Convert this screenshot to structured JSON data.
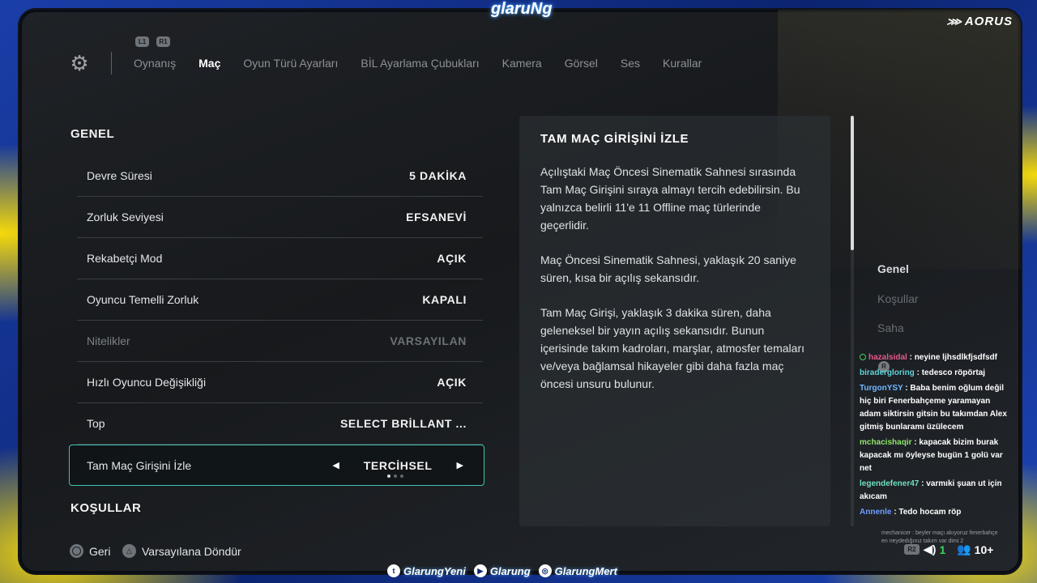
{
  "overlay": {
    "brand": "glaruNg",
    "aorus": "AORUS",
    "social": [
      {
        "icon": "twitter-icon",
        "glyph": "t",
        "label": "GlarungYeni"
      },
      {
        "icon": "youtube-icon",
        "glyph": "▶",
        "label": "Glarung"
      },
      {
        "icon": "instagram-icon",
        "glyph": "◎",
        "label": "GlarungMert"
      }
    ]
  },
  "nav": {
    "shoulder_left": "L1",
    "shoulder_right": "R1",
    "tabs": [
      "Oynanış",
      "Maç",
      "Oyun Türü Ayarları",
      "BİL Ayarlama Çubukları",
      "Kamera",
      "Görsel",
      "Ses",
      "Kurallar"
    ],
    "active_tab": "Maç"
  },
  "settings": {
    "section_general": "GENEL",
    "section_conditions": "KOŞULLAR",
    "rows": [
      {
        "label": "Devre Süresi",
        "value": "5 DAKİKA",
        "disabled": false
      },
      {
        "label": "Zorluk Seviyesi",
        "value": "EFSANEVİ",
        "disabled": false
      },
      {
        "label": "Rekabetçi Mod",
        "value": "AÇIK",
        "disabled": false
      },
      {
        "label": "Oyuncu Temelli Zorluk",
        "value": "KAPALI",
        "disabled": false
      },
      {
        "label": "Nitelikler",
        "value": "VARSAYILAN",
        "disabled": true
      },
      {
        "label": "Hızlı Oyuncu Değişikliği",
        "value": "AÇIK",
        "disabled": false
      },
      {
        "label": "Top",
        "value": "SELECT BRİLLANT ...",
        "disabled": false
      }
    ],
    "selected": {
      "label": "Tam Maç Girişini İzle",
      "value": "TERCİHSEL",
      "left_arrow": "◀",
      "right_arrow": "▶",
      "option_index": 1,
      "option_count": 3
    }
  },
  "description": {
    "title": "TAM MAÇ GİRİŞİNİ İZLE",
    "paragraphs": [
      "Açılıştaki Maç Öncesi Sinematik Sahnesi sırasında Tam Maç Girişini sıraya almayı tercih edebilirsin. Bu yalnızca belirli 11'e 11 Offline maç türlerinde geçerlidir.",
      "Maç Öncesi Sinematik Sahnesi, yaklaşık 20 saniye süren, kısa bir açılış sekansıdır.",
      "Tam Maç Girişi, yaklaşık 3 dakika süren, daha geleneksel bir yayın açılış sekansıdır. Bunun içerisinde takım kadroları, marşlar, atmosfer temaları ve/veya bağlamsal hikayeler gibi daha fazla maç öncesi unsuru bulunur."
    ]
  },
  "side_sections": [
    {
      "label": "Genel",
      "active": true
    },
    {
      "label": "Koşullar",
      "active": false
    },
    {
      "label": "Saha",
      "active": false
    }
  ],
  "chat": {
    "messages": [
      {
        "user": "hazalsidal",
        "color": "#e55a8a",
        "text": "neyine ljhsdlkfjsdfsdf",
        "online": true
      },
      {
        "user": "biradergloring",
        "color": "#5fd3d9",
        "text": "tedesco röpörtaj",
        "online": false
      },
      {
        "user": "TurgonYSY",
        "color": "#6fb8ff",
        "text": "Baba benim oğlum değil hiç biri Fenerbahçeme yaramayan adam siktirsin gitsin bu takımdan Alex gitmiş bunlaramı üzülecem",
        "online": false
      },
      {
        "user": "mchacishaqir",
        "color": "#8fe36a",
        "text": "kapacak bizim burak kapacak mı öyleyse bugün 1 golü var net",
        "online": false
      },
      {
        "user": "legendefener47",
        "color": "#6fe0c2",
        "text": "varmıki şuan ut için akıcam",
        "online": false
      },
      {
        "user": "Annenle",
        "color": "#6f9dff",
        "text": "Tedo hocam röp",
        "online": false
      }
    ],
    "faded_note": "mechanicer : beyler maçı akıyoruz fenerbahçe en neydedığınız takım var dimi 2",
    "r_badge": "R",
    "r2_badge": "R2",
    "stat_value": "1",
    "viewers": "10+"
  },
  "footer": {
    "back_label": "Geri",
    "reset_label": "Varsayılana Döndür"
  },
  "colors": {
    "accent": "#43c2b3",
    "stream_yellow": "#f5d90a",
    "stream_blue": "#1a3ea8"
  }
}
